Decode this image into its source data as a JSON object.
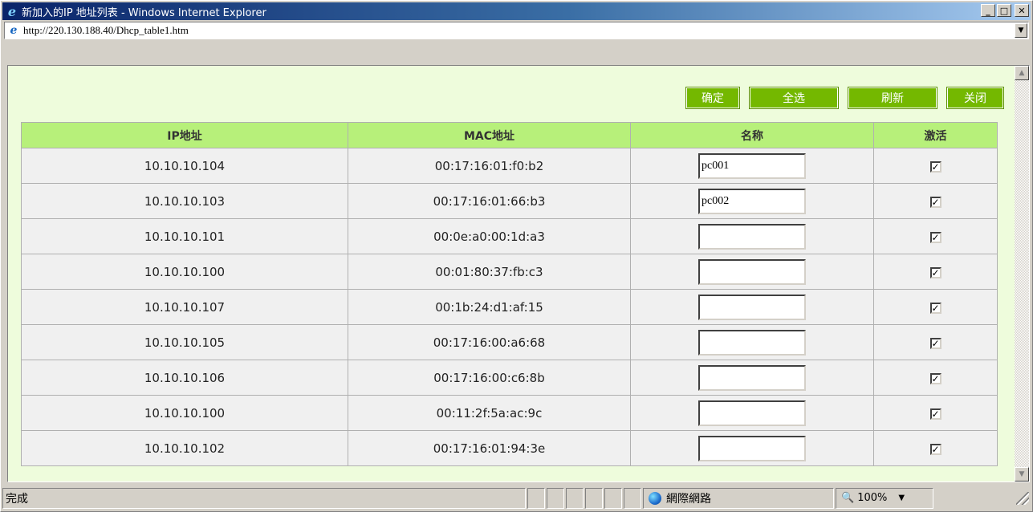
{
  "window": {
    "title": "新加入的IP 地址列表 - Windows Internet Explorer",
    "controls": {
      "minimize": "_",
      "maximize": "□",
      "close": "✕"
    }
  },
  "address_bar": {
    "url": "http://220.130.188.40/Dhcp_table1.htm"
  },
  "actions": {
    "confirm": "确定",
    "select_all": "全选",
    "refresh": "刷新",
    "close": "关闭"
  },
  "table": {
    "headers": {
      "ip": "IP地址",
      "mac": "MAC地址",
      "name": "名称",
      "active": "激活"
    },
    "rows": [
      {
        "ip": "10.10.10.104",
        "mac": "00:17:16:01:f0:b2",
        "name": "pc001",
        "active": true
      },
      {
        "ip": "10.10.10.103",
        "mac": "00:17:16:01:66:b3",
        "name": "pc002",
        "active": true
      },
      {
        "ip": "10.10.10.101",
        "mac": "00:0e:a0:00:1d:a3",
        "name": "",
        "active": true
      },
      {
        "ip": "10.10.10.100",
        "mac": "00:01:80:37:fb:c3",
        "name": "",
        "active": true
      },
      {
        "ip": "10.10.10.107",
        "mac": "00:1b:24:d1:af:15",
        "name": "",
        "active": true
      },
      {
        "ip": "10.10.10.105",
        "mac": "00:17:16:00:a6:68",
        "name": "",
        "active": true
      },
      {
        "ip": "10.10.10.106",
        "mac": "00:17:16:00:c6:8b",
        "name": "",
        "active": true
      },
      {
        "ip": "10.10.10.100",
        "mac": "00:11:2f:5a:ac:9c",
        "name": "",
        "active": true
      },
      {
        "ip": "10.10.10.102",
        "mac": "00:17:16:01:94:3e",
        "name": "",
        "active": true
      }
    ]
  },
  "status_bar": {
    "status": "完成",
    "zone": "網際網路",
    "zoom": "100%"
  },
  "colors": {
    "content_bg": "#eefcdc",
    "header_bg": "#b7f07a",
    "button_bg": "#74b800"
  }
}
